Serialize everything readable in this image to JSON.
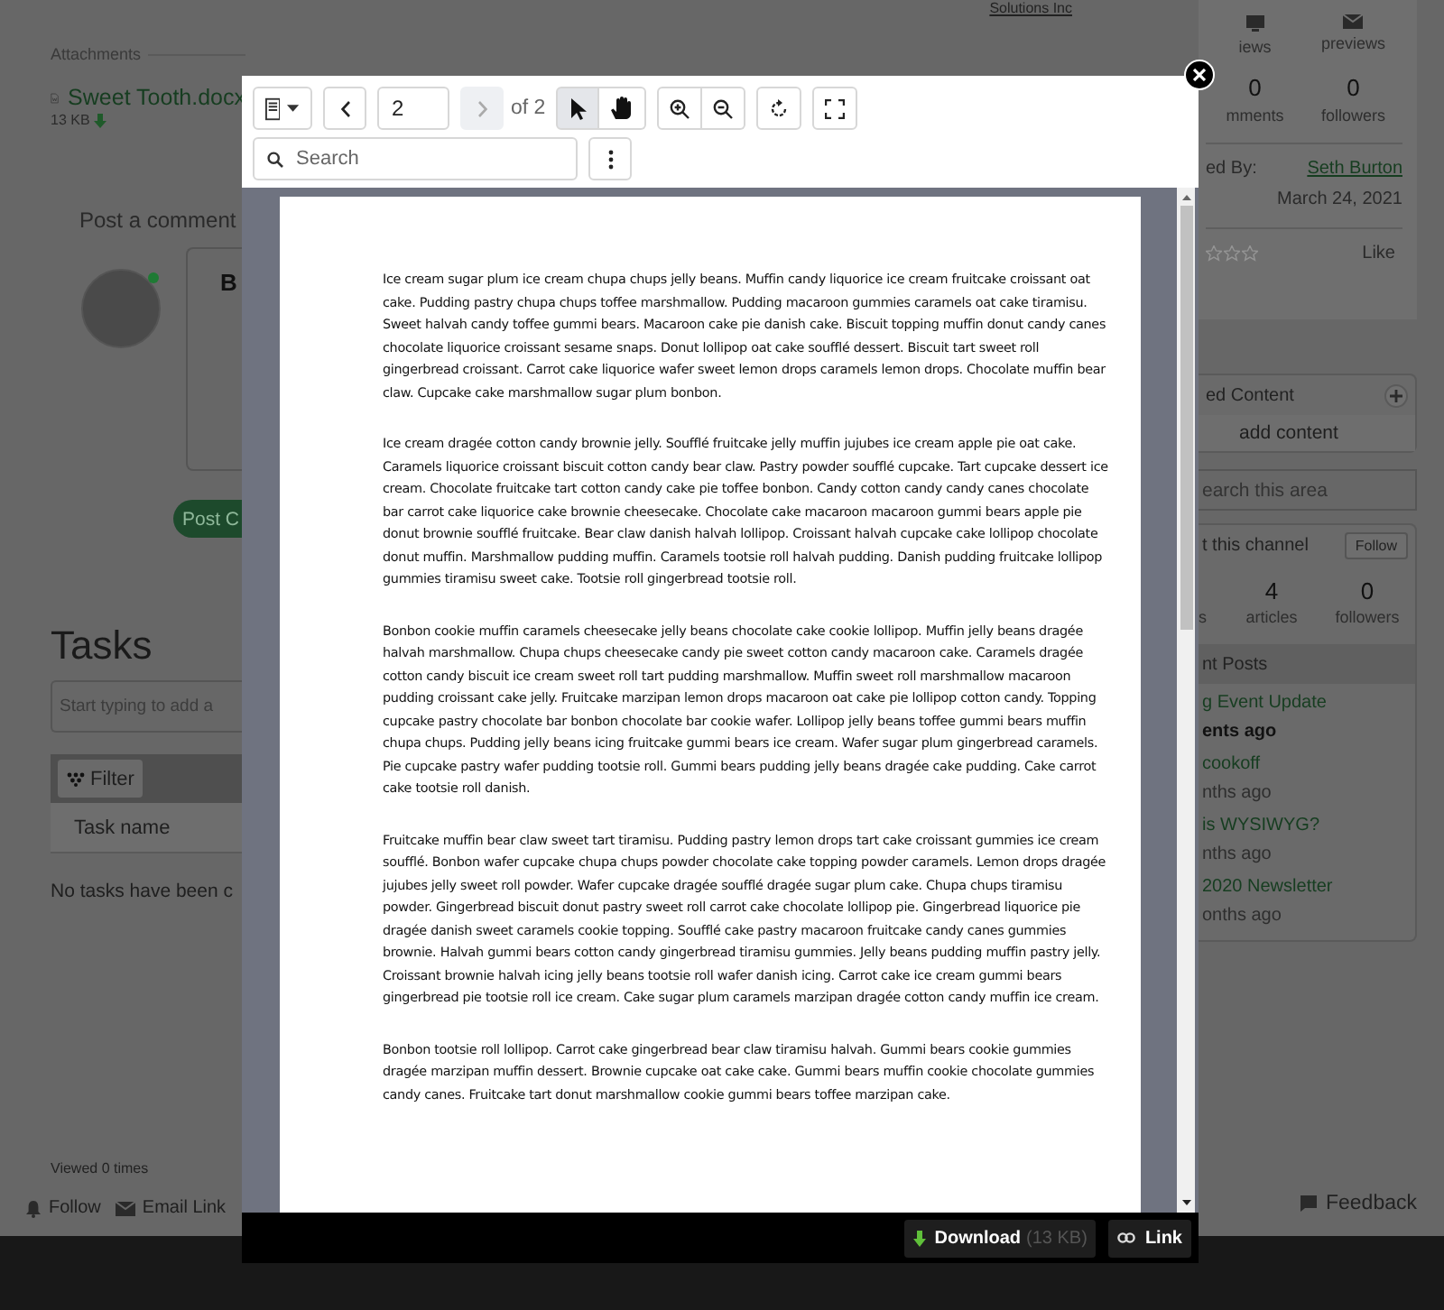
{
  "background": {
    "company": "Solutions Inc",
    "attachments": {
      "heading": "Attachments",
      "file_name": "Sweet Tooth.docx",
      "file_size": "13 KB"
    },
    "comment": {
      "heading": "Post a comment",
      "online": true,
      "editor_bold": "B",
      "post_button": "Post C"
    },
    "tasks": {
      "heading": "Tasks",
      "placeholder": "Start typing to add a",
      "filter": "Filter",
      "column": "Task name",
      "empty": "No tasks have been c"
    },
    "viewed": "Viewed 0 times",
    "actions": [
      {
        "kind": "follow",
        "label": "Follow"
      },
      {
        "kind": "email",
        "label": "Email Link"
      }
    ],
    "stat_icons": [
      {
        "kind": "monitor",
        "label": "iews"
      },
      {
        "kind": "envelope",
        "label": "previews"
      }
    ],
    "stat_counts": [
      {
        "value": "0",
        "label": "mments"
      },
      {
        "value": "0",
        "label": "followers"
      }
    ],
    "created_by": {
      "label": "ed By:",
      "name": "Seth Burton",
      "date": "March 24, 2021"
    },
    "rating": {
      "stars": 0,
      "like": "Like"
    },
    "related": {
      "heading": "ed Content",
      "add": "add content"
    },
    "area_search": {
      "placeholder": "earch this area"
    },
    "channel": {
      "heading": "t this channel",
      "follow": "Follow",
      "stats": [
        {
          "label": "s"
        },
        {
          "value": "4",
          "label": "articles"
        },
        {
          "value": "0",
          "label": "followers"
        }
      ]
    },
    "recent": {
      "heading": "nt Posts",
      "posts": [
        {
          "title": "g Event Update",
          "time": "ents ago",
          "highlighted": true
        },
        {
          "title": "cookoff",
          "time": "nths ago",
          "highlighted": false
        },
        {
          "title": "is WYSIWYG?",
          "time": "nths ago",
          "highlighted": false
        },
        {
          "title": "2020 Newsletter",
          "time": "onths ago",
          "highlighted": false
        }
      ]
    },
    "feedback": "Feedback"
  },
  "viewer": {
    "toolbar": {
      "prev": {
        "disabled": false
      },
      "page": "2",
      "next": {
        "disabled": true
      },
      "page_count": "of 2",
      "tools": [
        {
          "kind": "pointer",
          "selected": true
        },
        {
          "kind": "hand",
          "selected": false
        }
      ],
      "search": {
        "placeholder": "Search"
      }
    },
    "document": {
      "paragraphs": [
        "Ice cream sugar plum ice cream chupa chups jelly beans. Muffin candy liquorice ice cream fruitcake croissant oat cake. Pudding pastry chupa chups toffee marshmallow. Pudding macaroon gummies caramels oat cake tiramisu. Sweet halvah candy toffee gummi bears. Macaroon cake pie danish cake. Biscuit topping muffin donut candy canes chocolate liquorice croissant sesame snaps. Donut lollipop oat cake soufflé dessert. Biscuit tart sweet roll gingerbread croissant. Carrot cake liquorice wafer sweet lemon drops caramels lemon drops. Chocolate muffin bear claw. Cupcake cake marshmallow sugar plum bonbon.",
        "Ice cream dragée cotton candy brownie jelly. Soufflé fruitcake jelly muffin jujubes ice cream apple pie oat cake. Caramels liquorice croissant biscuit cotton candy bear claw. Pastry powder soufflé cupcake. Tart cupcake dessert ice cream. Chocolate fruitcake tart cotton candy cake pie toffee bonbon. Candy cotton candy candy canes chocolate bar carrot cake liquorice cake brownie cheesecake. Chocolate cake macaroon macaroon gummi bears apple pie donut brownie soufflé fruitcake. Bear claw danish halvah lollipop. Croissant halvah cupcake cake lollipop chocolate donut muffin. Marshmallow pudding muffin. Caramels tootsie roll halvah pudding. Danish pudding fruitcake lollipop gummies tiramisu sweet cake. Tootsie roll gingerbread tootsie roll.",
        "Bonbon cookie muffin caramels cheesecake jelly beans chocolate cake cookie lollipop. Muffin jelly beans dragée halvah marshmallow. Chupa chups cheesecake candy pie sweet cotton candy macaroon cake. Caramels dragée cotton candy biscuit ice cream sweet roll tart pudding marshmallow. Muffin sweet roll marshmallow macaroon pudding croissant cake jelly. Fruitcake marzipan lemon drops macaroon oat cake pie lollipop cotton candy. Topping cupcake pastry chocolate bar bonbon chocolate bar cookie wafer. Lollipop jelly beans toffee gummi bears muffin chupa chups. Pudding jelly beans icing fruitcake gummi bears ice cream. Wafer sugar plum gingerbread caramels. Pie cupcake pastry wafer pudding tootsie roll. Gummi bears pudding jelly beans dragée cake pudding. Cake carrot cake tootsie roll danish.",
        "Fruitcake muffin bear claw sweet tart tiramisu. Pudding pastry lemon drops tart cake croissant gummies ice cream soufflé. Bonbon wafer cupcake chupa chups powder chocolate cake topping powder caramels. Lemon drops dragée jujubes jelly sweet roll powder. Wafer cupcake dragée soufflé dragée sugar plum cake. Chupa chups tiramisu powder. Gingerbread biscuit donut pastry sweet roll carrot cake chocolate lollipop pie. Gingerbread liquorice pie dragée danish sweet caramels cookie topping. Soufflé cake pastry macaroon fruitcake candy canes gummies brownie. Halvah gummi bears cotton candy gingerbread tiramisu gummies. Jelly beans pudding muffin pastry jelly. Croissant brownie halvah icing jelly beans tootsie roll wafer danish icing. Carrot cake ice cream gummi bears gingerbread pie tootsie roll ice cream. Cake sugar plum caramels marzipan dragée cotton candy muffin ice cream.",
        "Bonbon tootsie roll lollipop. Carrot cake gingerbread bear claw tiramisu halvah. Gummi bears cookie gummies dragée marzipan muffin dessert. Brownie cupcake oat cake cake. Gummi bears muffin cookie chocolate gummies candy canes. Fruitcake tart donut marshmallow cookie gummi bears toffee marzipan cake."
      ]
    },
    "footer": {
      "download": "Download",
      "size": "(13 KB)",
      "link": "Link"
    }
  }
}
